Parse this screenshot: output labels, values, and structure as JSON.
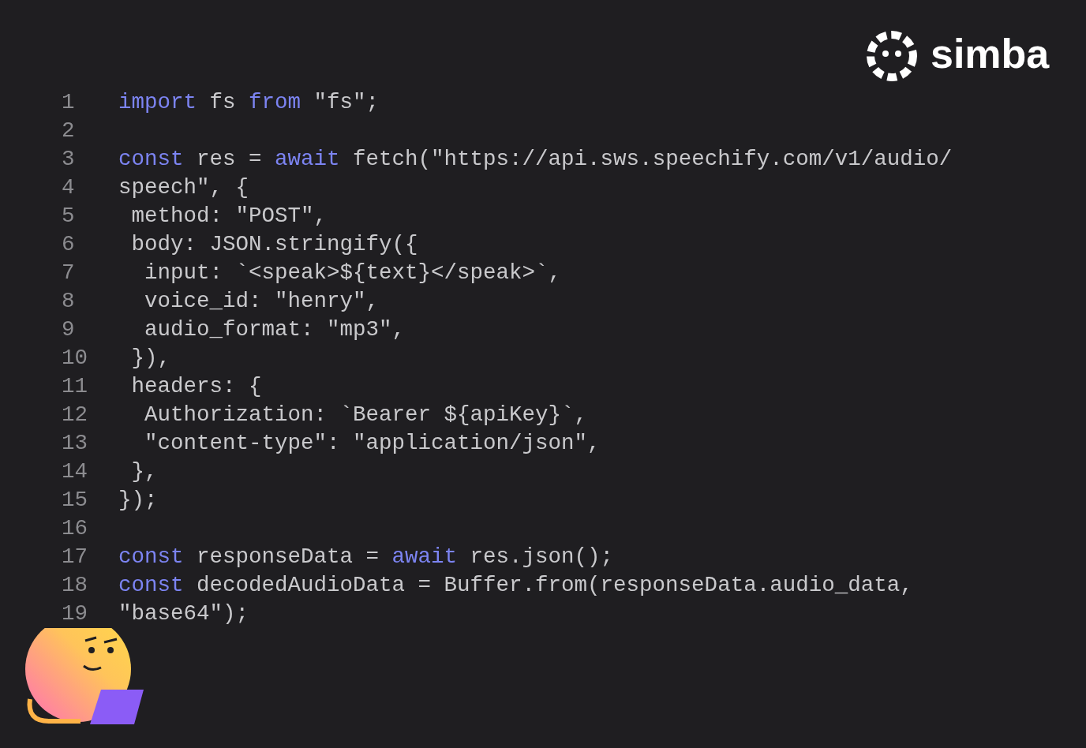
{
  "logo": {
    "text": "simba"
  },
  "code": {
    "lines": [
      {
        "number": "1",
        "tokens": [
          {
            "text": "import",
            "kind": "keyword"
          },
          {
            "text": " fs ",
            "kind": "plain"
          },
          {
            "text": "from",
            "kind": "keyword"
          },
          {
            "text": " \"fs\";",
            "kind": "plain"
          }
        ]
      },
      {
        "number": "2"
      },
      {
        "number": "3",
        "tokens": [
          {
            "text": "const",
            "kind": "keyword"
          },
          {
            "text": " res = ",
            "kind": "plain"
          },
          {
            "text": "await",
            "kind": "keyword"
          },
          {
            "text": " fetch(\"https://api.sws.speechify.com/v1/audio/",
            "kind": "plain"
          }
        ]
      },
      {
        "number": "4",
        "tokens": [
          {
            "text": "speech\", {",
            "kind": "plain"
          }
        ]
      },
      {
        "number": "5",
        "tokens": [
          {
            "text": " method: \"POST\",",
            "kind": "plain"
          }
        ]
      },
      {
        "number": "6",
        "tokens": [
          {
            "text": " body: JSON.stringify({",
            "kind": "plain"
          }
        ]
      },
      {
        "number": "7",
        "tokens": [
          {
            "text": "  input: `<speak>${text}</speak>`,",
            "kind": "plain"
          }
        ]
      },
      {
        "number": "8",
        "tokens": [
          {
            "text": "  voice_id: \"henry\",",
            "kind": "plain"
          }
        ]
      },
      {
        "number": "9",
        "tokens": [
          {
            "text": "  audio_format: \"mp3\",",
            "kind": "plain"
          }
        ]
      },
      {
        "number": "10",
        "tokens": [
          {
            "text": " }),",
            "kind": "plain"
          }
        ]
      },
      {
        "number": "11",
        "tokens": [
          {
            "text": " headers: {",
            "kind": "plain"
          }
        ]
      },
      {
        "number": "12",
        "tokens": [
          {
            "text": "  Authorization: `Bearer ${apiKey}`,",
            "kind": "plain"
          }
        ]
      },
      {
        "number": "13",
        "tokens": [
          {
            "text": "  \"content-type\": \"application/json\",",
            "kind": "plain"
          }
        ]
      },
      {
        "number": "14",
        "tokens": [
          {
            "text": " },",
            "kind": "plain"
          }
        ]
      },
      {
        "number": "15",
        "tokens": [
          {
            "text": "});",
            "kind": "plain"
          }
        ]
      },
      {
        "number": "16"
      },
      {
        "number": "17",
        "tokens": [
          {
            "text": "const",
            "kind": "keyword"
          },
          {
            "text": " responseData = ",
            "kind": "plain"
          },
          {
            "text": "await",
            "kind": "keyword"
          },
          {
            "text": " res.json();",
            "kind": "plain"
          }
        ]
      },
      {
        "number": "18",
        "tokens": [
          {
            "text": "const",
            "kind": "keyword"
          },
          {
            "text": " decodedAudioData = Buffer.from(responseData.audio_data,",
            "kind": "plain"
          }
        ]
      },
      {
        "number": "19",
        "tokens": [
          {
            "text": "\"base64\");",
            "kind": "plain"
          }
        ]
      }
    ]
  }
}
